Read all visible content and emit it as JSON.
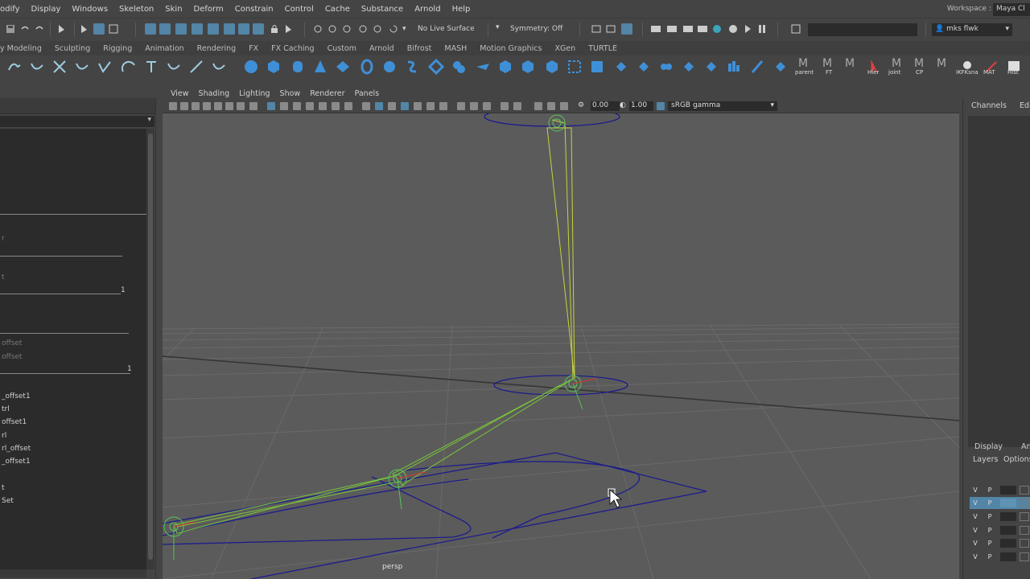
{
  "menubar": {
    "items": [
      "odify",
      "Display",
      "Windows",
      "Skeleton",
      "Skin",
      "Deform",
      "Constrain",
      "Control",
      "Cache",
      "Substance",
      "Arnold",
      "Help"
    ],
    "workspace_label": "Workspace :",
    "workspace_value": "Maya Cl"
  },
  "statusline": {
    "live_surface": "No Live Surface",
    "symmetry": "Symmetry: Off",
    "user": "mks flwk"
  },
  "shelf_tabs": [
    "y Modeling",
    "Sculpting",
    "Rigging",
    "Animation",
    "Rendering",
    "FX",
    "FX Caching",
    "Custom",
    "Arnold",
    "Bifrost",
    "MASH",
    "Motion Graphics",
    "XGen",
    "TURTLE"
  ],
  "shelf_labels": [
    "parent",
    "FT",
    "Hier",
    "joint",
    "CP",
    "IKFKsna",
    "MAT",
    "Hist"
  ],
  "viewport": {
    "menus": [
      "View",
      "Shading",
      "Lighting",
      "Show",
      "Renderer",
      "Panels"
    ],
    "exposure": "0.00",
    "gamma": "1.00",
    "color_space": "sRGB gamma",
    "camera": "persp"
  },
  "outliner": {
    "rows": [
      {
        "text": "r",
        "dim": true
      },
      {
        "text": "t",
        "dim": true
      },
      {
        "text": "1",
        "dim": false
      },
      {
        "text": "offset",
        "dim": true
      },
      {
        "text": "offset",
        "dim": true
      },
      {
        "text": "_offset1",
        "dim": false
      },
      {
        "text": "trl",
        "dim": false
      },
      {
        "text": "offset1",
        "dim": false
      },
      {
        "text": "rl",
        "dim": false
      },
      {
        "text": "rl_offset",
        "dim": false
      },
      {
        "text": "_offset1",
        "dim": false
      },
      {
        "text": "t",
        "dim": false
      },
      {
        "text": "Set",
        "dim": false
      }
    ],
    "rule_labels": [
      "1",
      "1"
    ]
  },
  "rightpanel": {
    "tabs": [
      "Channels",
      "Edit"
    ],
    "layer_tabs": [
      "Display",
      "Anim"
    ],
    "layer_menus": [
      "Layers",
      "Options"
    ],
    "layer_rows": [
      {
        "v": "V",
        "p": "P"
      },
      {
        "v": "V",
        "p": "P"
      },
      {
        "v": "V",
        "p": "P"
      },
      {
        "v": "V",
        "p": "P"
      },
      {
        "v": "V",
        "p": "P"
      },
      {
        "v": "V",
        "p": "P"
      }
    ]
  },
  "colors": {
    "selection": "#5285a6",
    "joint_green": "#58c35a",
    "bone_yellow": "#c8d23c",
    "curve_blue": "#1c1c8c"
  }
}
